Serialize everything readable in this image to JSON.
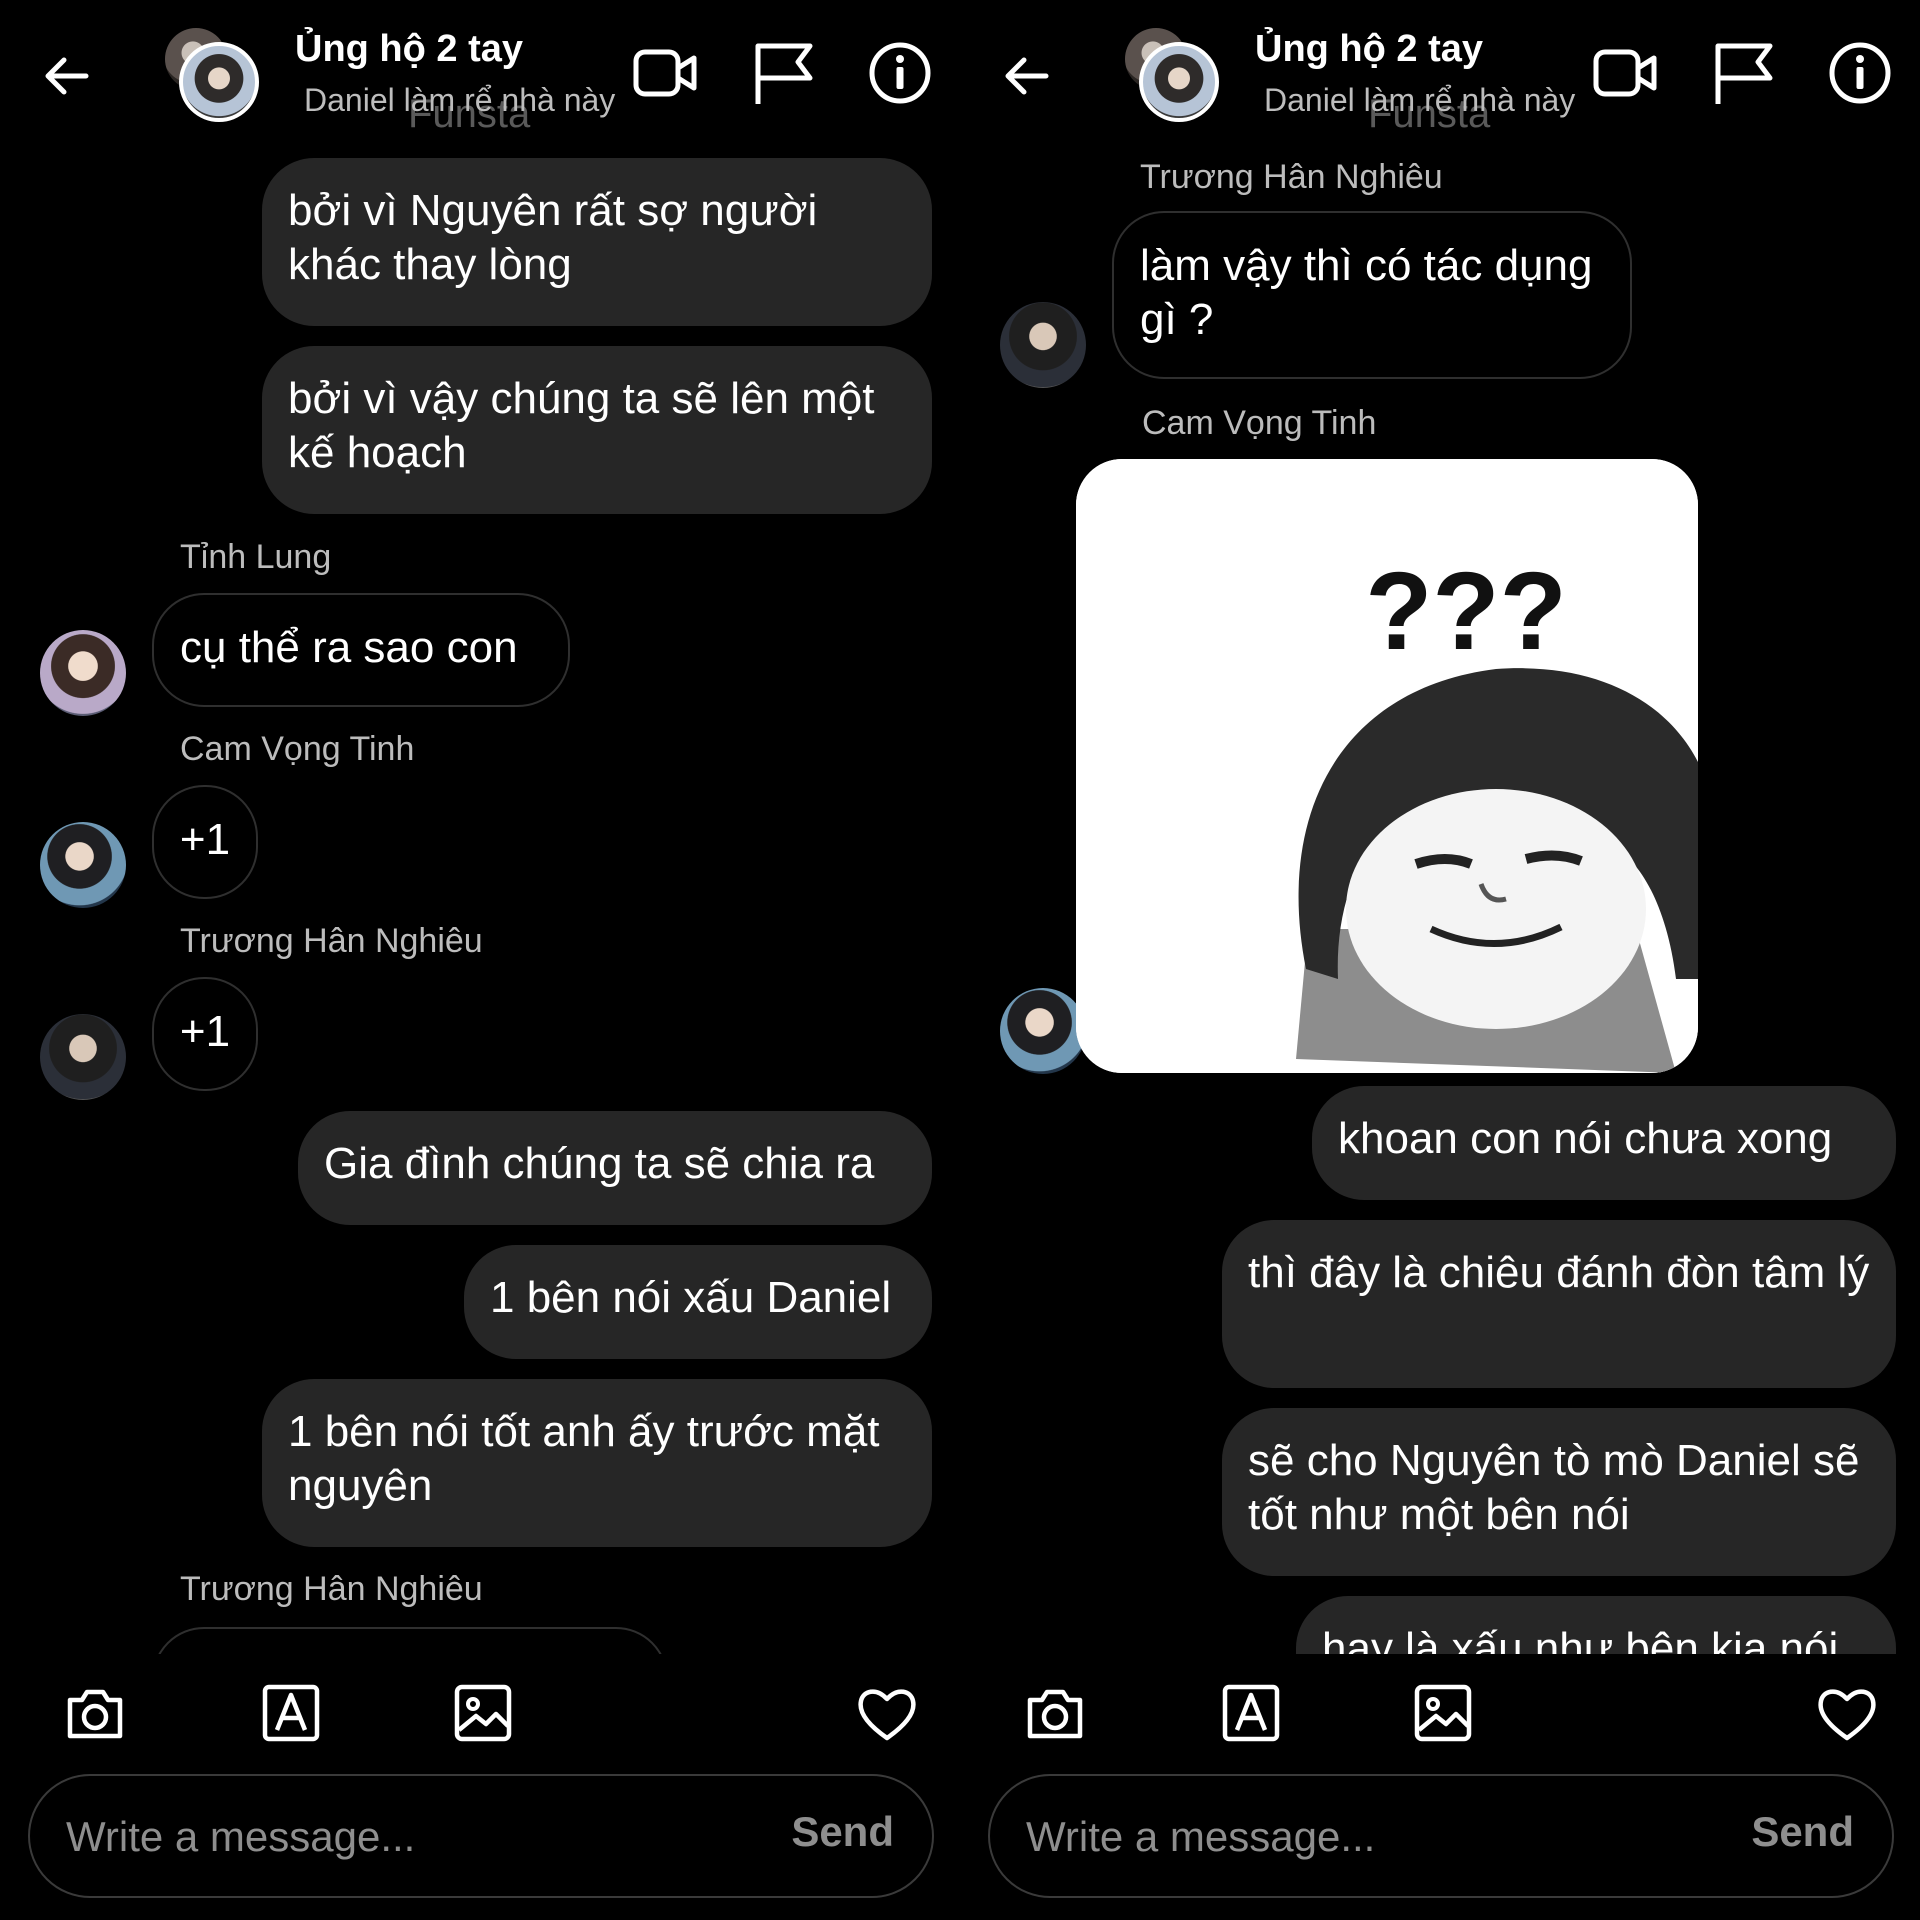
{
  "header": {
    "title": "Ủng hộ 2 tay",
    "subtitle": "Daniel làm rể nhà này",
    "watermark": "Funsta"
  },
  "composer": {
    "placeholder": "Write a message...",
    "send_label": "Send"
  },
  "left": {
    "bubble_1": "bởi vì Nguyên rất sợ người khác thay lòng",
    "bubble_2": "bởi vì vậy chúng ta sẽ lên một kế hoạch",
    "sender_tinh": "Tỉnh Lung",
    "bubble_tinh": "cụ thể ra sao con",
    "sender_cam": "Cam Vọng Tinh",
    "bubble_cam": "+1",
    "sender_truong_1": "Trương Hân Nghiêu",
    "bubble_truong_1": "+1",
    "bubble_3": "Gia đình chúng ta sẽ chia ra",
    "bubble_4": "1 bên nói xấu Daniel",
    "bubble_5": "1 bên nói tốt anh ấy trước mặt nguyên",
    "sender_truong_2": "Trương Hân Nghiêu"
  },
  "right": {
    "sender_truong": "Trương Hân Nghiêu",
    "bubble_truong": "làm vậy thì có tác dụng gì ?",
    "sender_cam": "Cam Vọng Tinh",
    "sticker_text": "???",
    "bubble_1": "khoan con nói chưa xong",
    "bubble_2": "thì đây là chiêu đánh đòn tâm lý",
    "bubble_3": "sẽ cho Nguyên tò mò Daniel sẽ tốt như một bên nói",
    "bubble_4": "hay là xấu như bên kia nói"
  }
}
